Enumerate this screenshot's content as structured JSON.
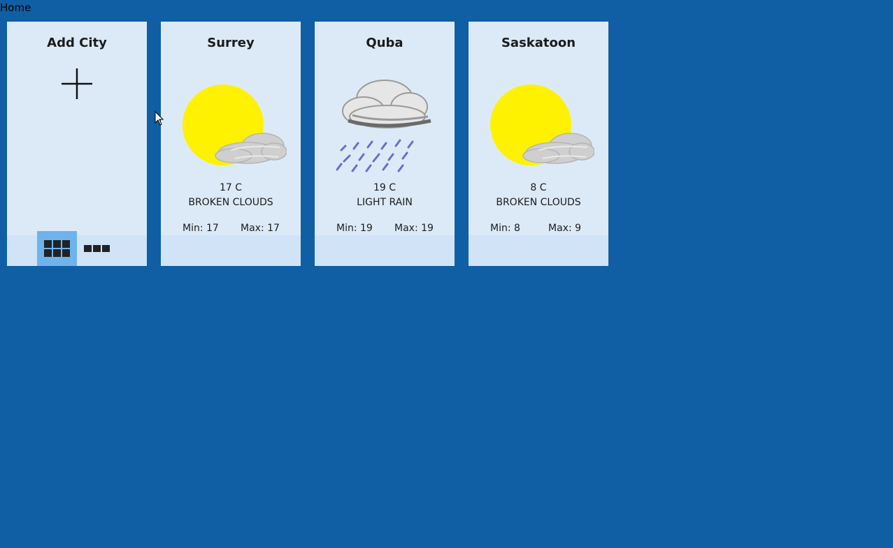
{
  "header": {
    "title": "Home"
  },
  "add_card": {
    "title": "Add City",
    "view_modes": [
      {
        "name": "grid-view",
        "active": true
      },
      {
        "name": "list-view",
        "active": false
      }
    ]
  },
  "cities": [
    {
      "name": "Surrey",
      "temp": "17 C",
      "desc": "BROKEN CLOUDS",
      "min": "Min: 17",
      "max": "Max: 17",
      "icon": "sun-cloud-icon"
    },
    {
      "name": "Quba",
      "temp": "19 C",
      "desc": "LIGHT RAIN",
      "min": "Min: 19",
      "max": "Max: 19",
      "icon": "rain-cloud-icon"
    },
    {
      "name": "Saskatoon",
      "temp": "8 C",
      "desc": "BROKEN CLOUDS",
      "min": "Min: 8",
      "max": "Max: 9",
      "icon": "sun-cloud-icon"
    }
  ],
  "colors": {
    "background": "#105ea3",
    "card": "#dceaf8",
    "card_footer": "#d0e3f7",
    "active_toggle": "#6eb3ec",
    "sun": "#fff200"
  }
}
